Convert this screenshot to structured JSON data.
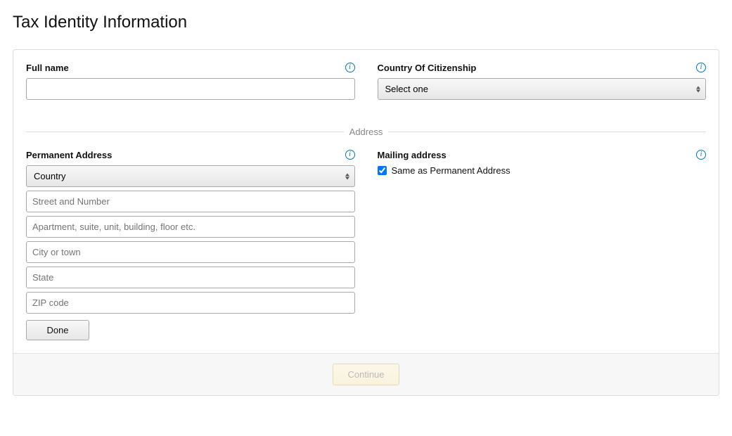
{
  "page_title": "Tax Identity Information",
  "full_name": {
    "label": "Full name",
    "value": ""
  },
  "citizenship": {
    "label": "Country Of Citizenship",
    "selected": "Select one"
  },
  "address_section_label": "Address",
  "permanent_address": {
    "label": "Permanent Address",
    "country_selected": "Country",
    "street_placeholder": "Street and Number",
    "apt_placeholder": "Apartment, suite, unit, building, floor etc.",
    "city_placeholder": "City or town",
    "state_placeholder": "State",
    "zip_placeholder": "ZIP code",
    "done_label": "Done"
  },
  "mailing_address": {
    "label": "Mailing address",
    "same_as_label": "Same as Permanent Address",
    "same_as_checked": true
  },
  "continue_label": "Continue",
  "info_glyph": "i"
}
